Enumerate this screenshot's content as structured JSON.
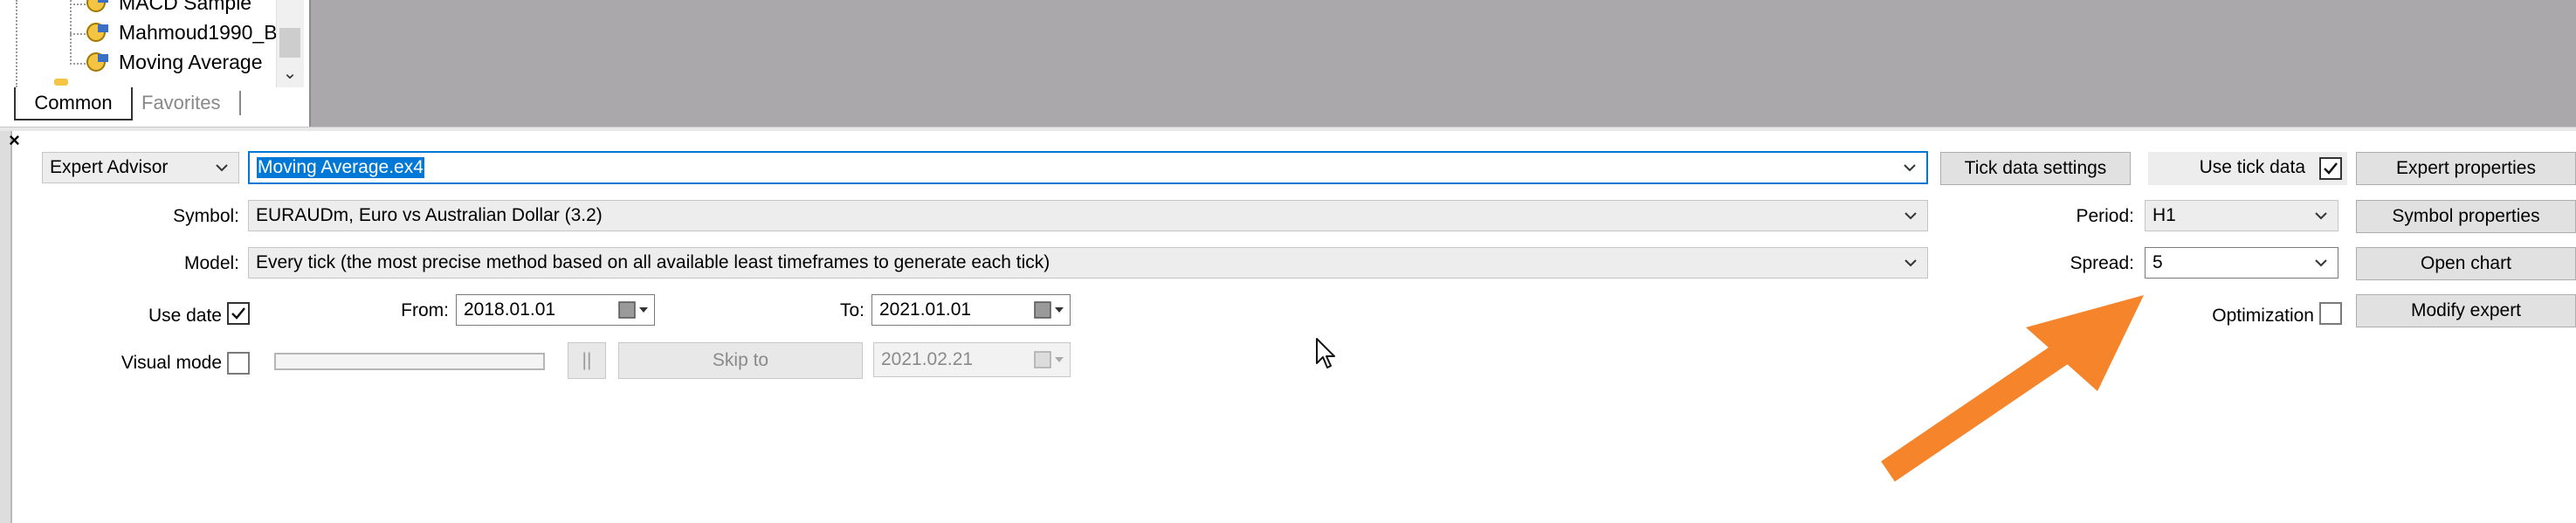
{
  "navigator": {
    "items": [
      "MACD Sample",
      "Mahmoud1990_B",
      "Moving Average"
    ],
    "tabs": [
      "Common",
      "Favorites"
    ]
  },
  "tester": {
    "close_label": "×",
    "program_type": "Expert Advisor",
    "program_file": "Moving Average.ex4",
    "symbol_label": "Symbol:",
    "symbol_value": "EURAUDm, Euro vs Australian Dollar (3.2)",
    "model_label": "Model:",
    "model_value": "Every tick (the most precise method based on all available least timeframes to generate each tick)",
    "use_date_label": "Use date",
    "use_date_checked": true,
    "from_label": "From:",
    "from_value": "2018.01.01",
    "to_label": "To:",
    "to_value": "2021.01.01",
    "visual_mode_label": "Visual mode",
    "pause_label": "||",
    "skip_to_label": "Skip to",
    "skip_to_value": "2021.02.21",
    "tick_data_settings": "Tick data settings",
    "use_tick_data_label": "Use tick data",
    "use_tick_data_checked": true,
    "period_label": "Period:",
    "period_value": "H1",
    "spread_label": "Spread:",
    "spread_value": "5",
    "optimization_label": "Optimization",
    "expert_properties": "Expert properties",
    "symbol_properties": "Symbol properties",
    "open_chart": "Open chart",
    "modify_expert": "Modify expert"
  },
  "colors": {
    "selection": "#0078d7",
    "annotation_arrow": "#f5842a",
    "top_panel": "#aba8ab"
  }
}
